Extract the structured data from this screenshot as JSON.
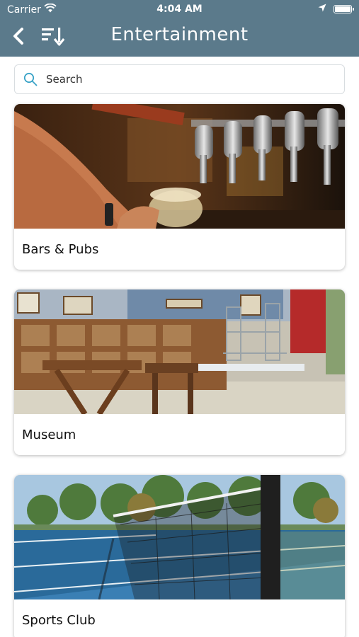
{
  "status_bar": {
    "carrier": "Carrier",
    "time": "4:04 AM"
  },
  "header": {
    "title": "Entertainment"
  },
  "search": {
    "placeholder": "Search"
  },
  "categories": [
    {
      "label": "Bars & Pubs"
    },
    {
      "label": "Museum"
    },
    {
      "label": "Sports Club"
    }
  ],
  "colors": {
    "header_bg": "#5b7a8b",
    "search_icon": "#3aa3c7"
  }
}
